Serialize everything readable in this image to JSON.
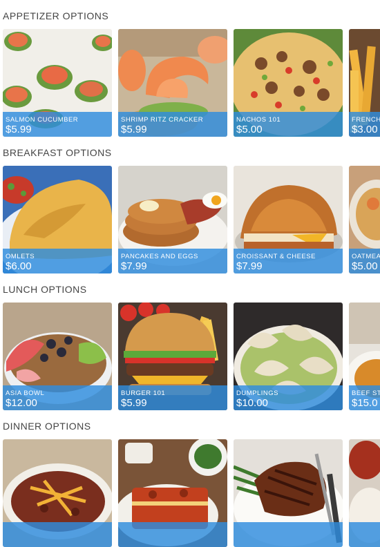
{
  "sections": [
    {
      "title": "APPETIZER OPTIONS",
      "items": [
        {
          "name": "SALMON CUCUMBER",
          "price": "$5.99"
        },
        {
          "name": "SHRIMP RITZ CRACKER",
          "price": "$5.99"
        },
        {
          "name": "NACHOS 101",
          "price": "$5.00"
        },
        {
          "name": "FRENCH",
          "price": "$3.00"
        }
      ]
    },
    {
      "title": "BREAKFAST OPTIONS",
      "items": [
        {
          "name": "OMLETS",
          "price": "$6.00"
        },
        {
          "name": "PANCAKES AND EGGS",
          "price": "$7.99"
        },
        {
          "name": "CROISSANT & CHEESE",
          "price": "$7.99"
        },
        {
          "name": "OATMEA",
          "price": "$5.00"
        }
      ]
    },
    {
      "title": "LUNCH OPTIONS",
      "items": [
        {
          "name": "ASIA BOWL",
          "price": "$12.00"
        },
        {
          "name": "BURGER 101",
          "price": "$5.99"
        },
        {
          "name": "DUMPLINGS",
          "price": "$10.00"
        },
        {
          "name": "BEEF ST",
          "price": "$15.0"
        }
      ]
    },
    {
      "title": "DINNER OPTIONS",
      "items": [
        {
          "name": "",
          "price": ""
        },
        {
          "name": "",
          "price": ""
        },
        {
          "name": "",
          "price": ""
        },
        {
          "name": "",
          "price": ""
        }
      ]
    }
  ],
  "colors": {
    "label_overlay": "#2e8cde",
    "background": "#ffffff"
  }
}
